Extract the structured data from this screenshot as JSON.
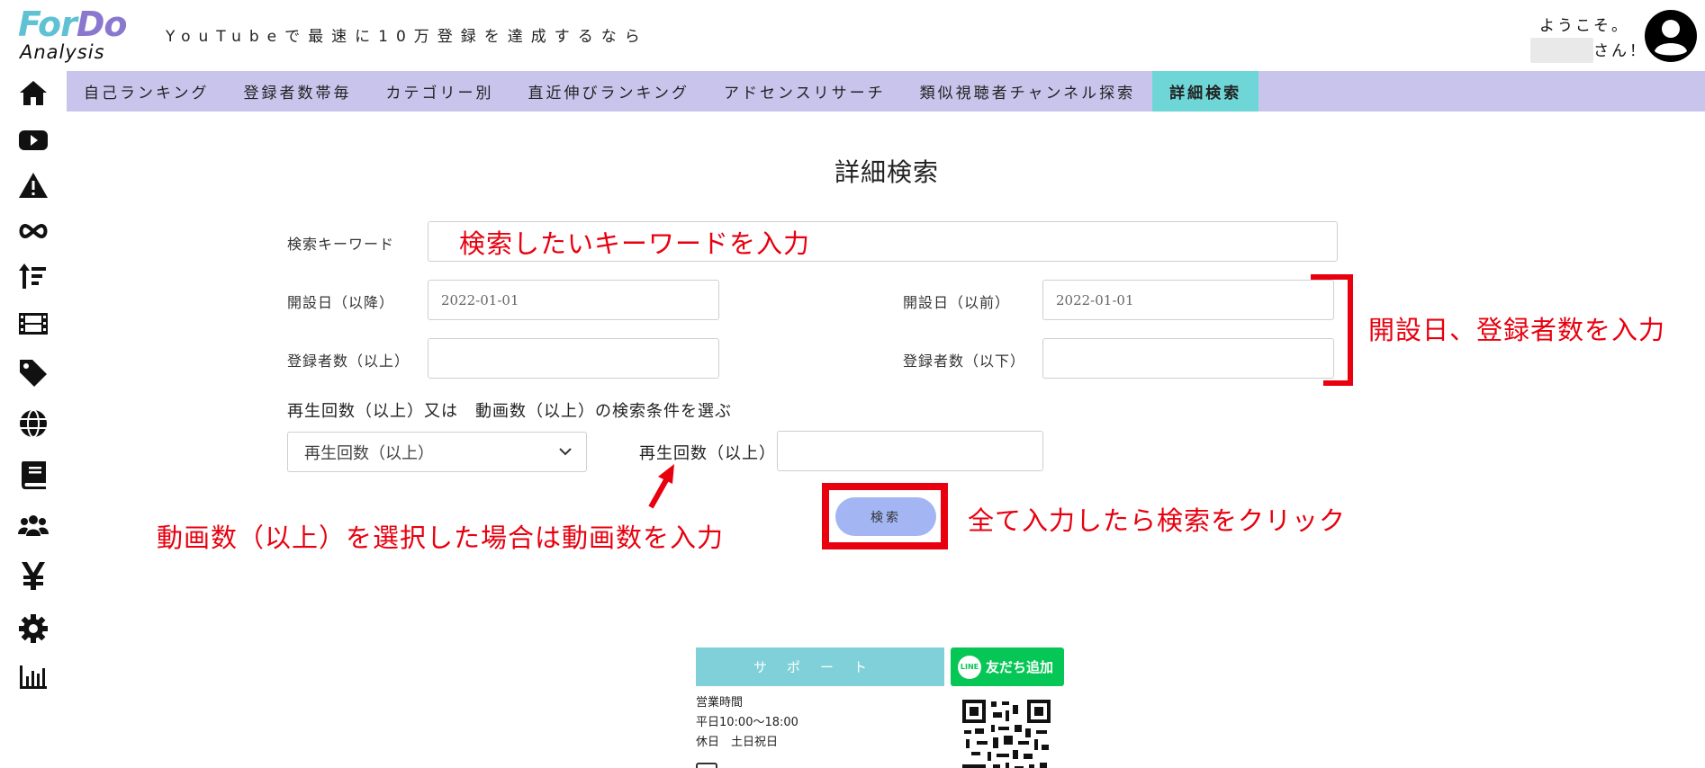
{
  "header": {
    "logo_for": "For",
    "logo_do": "Do",
    "logo_sub": "Analysis",
    "tagline": "YouTubeで最速に10万登録を達成するなら",
    "welcome": "ようこそ。",
    "user_suffix": "さん！"
  },
  "nav": {
    "items": [
      {
        "label": "自己ランキング"
      },
      {
        "label": "登録者数帯毎"
      },
      {
        "label": "カテゴリー別"
      },
      {
        "label": "直近伸びランキング"
      },
      {
        "label": "アドセンスリサーチ"
      },
      {
        "label": "類似視聴者チャンネル探索"
      },
      {
        "label": "詳細検索",
        "active": true
      }
    ]
  },
  "sidebar": {
    "icons": [
      "home-icon",
      "youtube-icon",
      "warning-icon",
      "infinity-icon",
      "sort-icon",
      "film-icon",
      "tag-icon",
      "globe-icon",
      "book-icon",
      "users-icon",
      "yen-icon",
      "gear-icon",
      "bar-chart-icon"
    ]
  },
  "form": {
    "title": "詳細検索",
    "keyword_label": "検索キーワード",
    "keyword_value": "",
    "open_after_label": "開設日（以降）",
    "open_after_value": "2022-01-01",
    "open_before_label": "開設日（以前）",
    "open_before_value": "2022-01-01",
    "subs_min_label": "登録者数（以上）",
    "subs_min_value": "",
    "subs_max_label": "登録者数（以下）",
    "subs_max_value": "",
    "condition_text": "再生回数（以上）又は　動画数（以上）の検索条件を選ぶ",
    "select_value": "再生回数（以上）",
    "count_label": "再生回数（以上）",
    "count_value": "",
    "search_button": "検索"
  },
  "annotations": {
    "keyword": "検索したいキーワードを入力",
    "dates": "開設日、登録者数を入力",
    "video_count": "動画数（以上）を選択した場合は動画数を入力",
    "click": "全て入力したら検索をクリック",
    "color": "#e8000f"
  },
  "footer": {
    "support": "サポート",
    "line_logo": "LINE",
    "line_button": "友だち追加",
    "hours_title": "営業時間",
    "hours_weekday": "平日10:00〜18:00",
    "hours_holiday": "休日　土日祝日"
  },
  "colors": {
    "nav_bg": "#c9c4ec",
    "nav_active": "#6fd6d8",
    "search_button": "#a3b6f3",
    "support_bg": "#7fd0d8",
    "line_green": "#06c755",
    "logo_cyan": "#5fc1d4",
    "logo_purple": "#8a78cf"
  }
}
